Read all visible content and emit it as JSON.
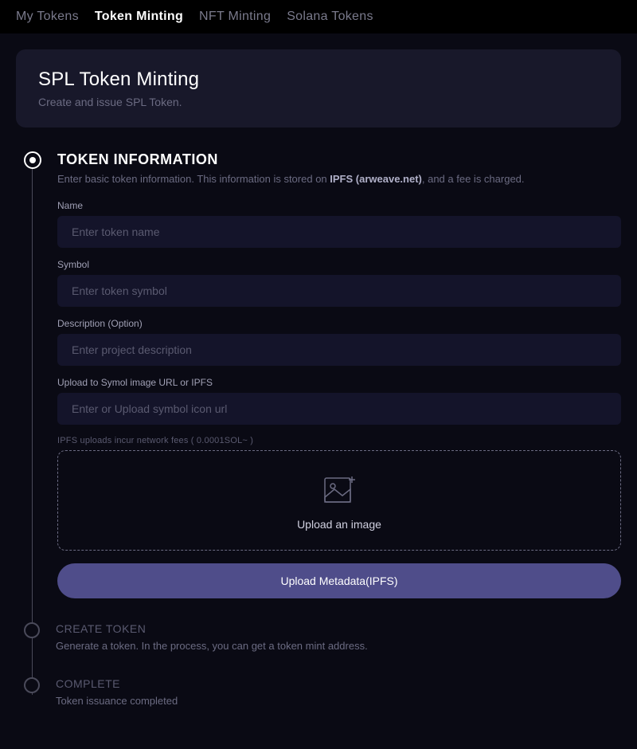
{
  "tabs": [
    {
      "label": "My Tokens",
      "active": false
    },
    {
      "label": "Token Minting",
      "active": true
    },
    {
      "label": "NFT Minting",
      "active": false
    },
    {
      "label": "Solana Tokens",
      "active": false
    }
  ],
  "header": {
    "title": "SPL Token Minting",
    "description": "Create and issue SPL Token."
  },
  "step1": {
    "title": "TOKEN INFORMATION",
    "desc_prefix": "Enter basic token information. This information is stored on ",
    "desc_strong": "IPFS (arweave.net)",
    "desc_suffix": ", and a fee is charged.",
    "name_label": "Name",
    "name_placeholder": "Enter token name",
    "symbol_label": "Symbol",
    "symbol_placeholder": "Enter token symbol",
    "description_label": "Description (Option)",
    "description_placeholder": "Enter project description",
    "upload_url_label": "Upload to Symol image URL or IPFS",
    "upload_url_placeholder": "Enter or Upload symbol icon url",
    "ipfs_note": "IPFS uploads incur network fees ( 0.0001SOL~ )",
    "upload_area_text": "Upload an image",
    "upload_button": "Upload Metadata(IPFS)"
  },
  "step2": {
    "title": "CREATE TOKEN",
    "desc": "Generate a token. In the process, you can get a token mint address."
  },
  "step3": {
    "title": "COMPLETE",
    "desc": "Token issuance completed"
  }
}
